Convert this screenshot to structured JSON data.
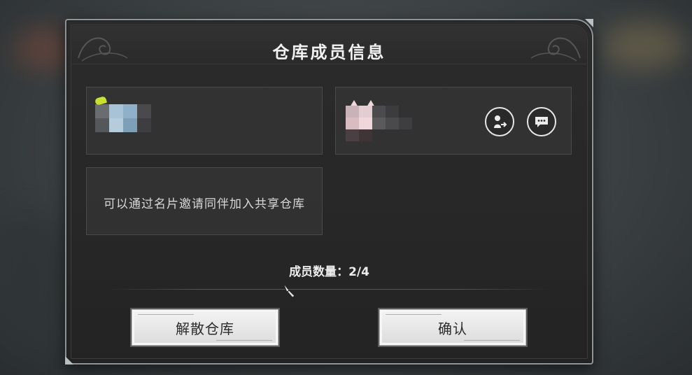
{
  "dialog": {
    "title": "仓库成员信息",
    "invite_hint": "可以通过名片邀请同伴加入共享仓库",
    "member_count_label": "成员数量：",
    "member_count": "2/4",
    "buttons": {
      "dissolve": "解散仓库",
      "confirm": "确认"
    }
  },
  "members": [
    {
      "slot": 1,
      "avatar_icon": "pixelated-avatar-icon",
      "badge_icon": "leaf-badge-icon",
      "actions": []
    },
    {
      "slot": 2,
      "avatar_icon": "pixelated-avatar-icon",
      "actions": [
        "transfer-owner-icon",
        "chat-icon"
      ]
    }
  ],
  "colors": {
    "panel_bg": "#2a2a2a",
    "panel_border": "#8f9597",
    "title_text": "#f2f2f2",
    "button_bg": "#e8e8e8",
    "button_text": "#2b2b2b",
    "badge": "#c8e030"
  }
}
